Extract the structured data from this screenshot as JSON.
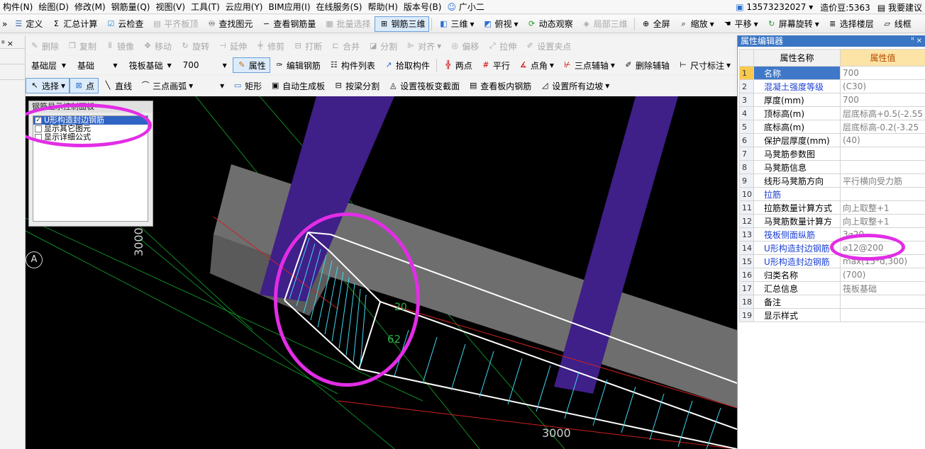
{
  "menu": {
    "items": [
      "构件(N)",
      "绘图(D)",
      "修改(M)",
      "钢筋量(Q)",
      "视图(V)",
      "工具(T)",
      "云应用(Y)",
      "BIM应用(I)",
      "在线服务(S)",
      "帮助(H)",
      "版本号(B)",
      "广小二"
    ],
    "phone": "13573232027",
    "beans": "造价豆:5363",
    "suggest": "我要建议"
  },
  "toolbar1": {
    "define": "定义",
    "sum": "汇总计算",
    "cloud_check": "云检查",
    "align_top": "平齐板顶",
    "find": "查找图元",
    "view_rebar": "查看钢筋量",
    "batch": "批量选择",
    "rebar3d": "钢筋三维",
    "view3d": "三维",
    "top_view": "俯视",
    "dynamic": "动态观察",
    "local3d": "局部三维",
    "fullscreen": "全屏",
    "zoom": "缩放",
    "pan": "平移",
    "rotate": "屏幕旋转",
    "select_floor": "选择楼层",
    "wireframe": "线框"
  },
  "toolbar2": {
    "delete": "删除",
    "copy": "复制",
    "mirror": "镜像",
    "move": "移动",
    "rotate": "旋转",
    "extend": "延伸",
    "trim": "修剪",
    "break": "打断",
    "merge": "合并",
    "split": "分割",
    "align": "对齐",
    "offset": "偏移",
    "stretch": "拉伸",
    "set_grip": "设置夹点"
  },
  "toolbar3": {
    "layer": "基础层",
    "category": "基础",
    "type": "筏板基础",
    "size": "700",
    "props": "属性",
    "edit_rebar": "编辑钢筋",
    "component_list": "构件列表",
    "pick": "拾取构件",
    "two_points": "两点",
    "parallel": "平行",
    "point_angle": "点角",
    "three_point_axis": "三点辅轴",
    "delete_axis": "删除辅轴",
    "dimension": "尺寸标注"
  },
  "toolbar4": {
    "select": "选择",
    "point": "点",
    "line": "直线",
    "arc": "三点画弧",
    "rect": "矩形",
    "auto_slab": "自动生成板",
    "split_beam": "按梁分割",
    "set_section": "设置筏板变截面",
    "view_inner_rebar": "查看板内钢筋",
    "set_slopes": "设置所有边坡"
  },
  "control_panel": {
    "title": "钢筋显示控制面板",
    "items": [
      {
        "label": "U形构造封边钢筋",
        "checked": true
      },
      {
        "label": "显示其它图元",
        "checked": false
      },
      {
        "label": "显示详细公式",
        "checked": false
      }
    ]
  },
  "viewport": {
    "dim_vertical": "3000",
    "dim_horizontal": "3000",
    "axis_label": "A",
    "rebar_label_1": "20",
    "rebar_label_2": "62"
  },
  "properties": {
    "title": "属性编辑器",
    "col_name": "属性名称",
    "col_value": "属性值",
    "rows": [
      {
        "no": "1",
        "name": "名称",
        "value": "700",
        "blue": false
      },
      {
        "no": "2",
        "name": "混凝土强度等级",
        "value": "(C30)",
        "blue": true
      },
      {
        "no": "3",
        "name": "厚度(mm)",
        "value": "700",
        "blue": false
      },
      {
        "no": "4",
        "name": "顶标高(m)",
        "value": "层底标高+0.5(-2.55",
        "blue": false
      },
      {
        "no": "5",
        "name": "底标高(m)",
        "value": "层底标高-0.2(-3.25",
        "blue": false
      },
      {
        "no": "6",
        "name": "保护层厚度(mm)",
        "value": "(40)",
        "blue": false
      },
      {
        "no": "7",
        "name": "马凳筋参数图",
        "value": "",
        "blue": false
      },
      {
        "no": "8",
        "name": "马凳筋信息",
        "value": "",
        "blue": false
      },
      {
        "no": "9",
        "name": "线形马凳筋方向",
        "value": "平行横向受力筋",
        "blue": false
      },
      {
        "no": "10",
        "name": "拉筋",
        "value": "",
        "blue": true
      },
      {
        "no": "11",
        "name": "拉筋数量计算方式",
        "value": "向上取整+1",
        "blue": false
      },
      {
        "no": "12",
        "name": "马凳筋数量计算方",
        "value": "向上取整+1",
        "blue": false
      },
      {
        "no": "13",
        "name": "筏板侧面纵筋",
        "value": "3⌀20",
        "blue": true
      },
      {
        "no": "14",
        "name": "U形构造封边钢筋",
        "value": "⌀12@200",
        "blue": true
      },
      {
        "no": "15",
        "name": "U形构造封边钢筋",
        "value": "max(15*d,300)",
        "blue": true
      },
      {
        "no": "16",
        "name": "归类名称",
        "value": "(700)",
        "blue": false
      },
      {
        "no": "17",
        "name": "汇总信息",
        "value": "筏板基础",
        "blue": false
      },
      {
        "no": "18",
        "name": "备注",
        "value": "",
        "blue": false
      },
      {
        "no": "19",
        "name": "显示样式",
        "value": "",
        "blue": false
      }
    ]
  }
}
